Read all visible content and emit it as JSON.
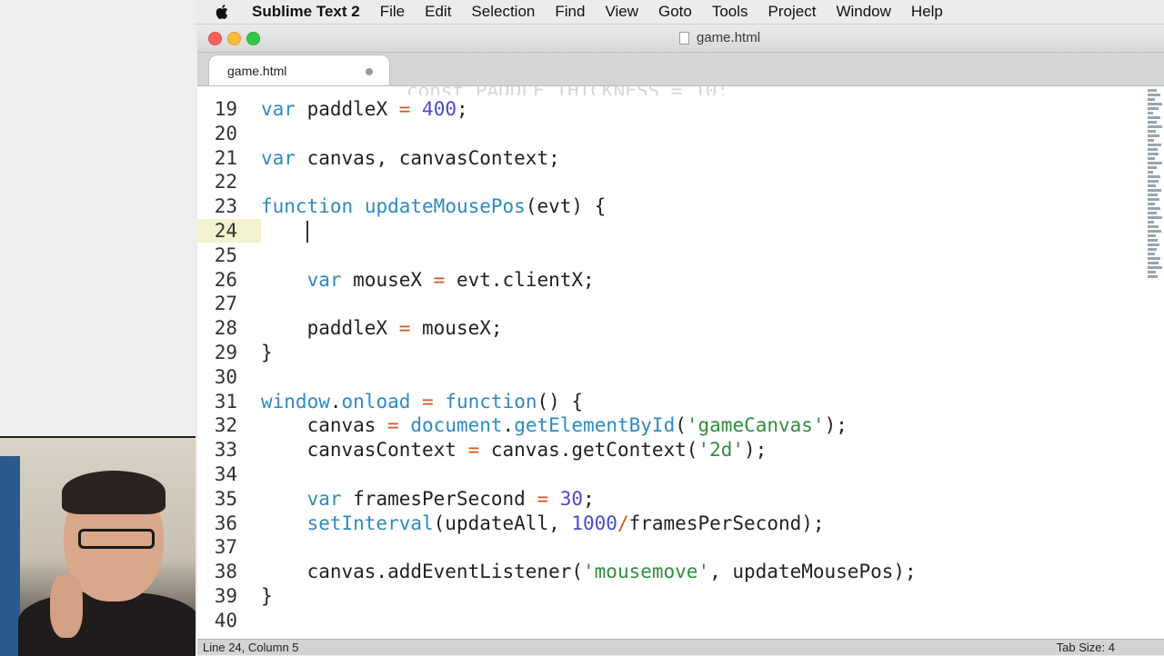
{
  "menubar": {
    "app_name": "Sublime Text 2",
    "items": [
      "File",
      "Edit",
      "Selection",
      "Find",
      "View",
      "Goto",
      "Tools",
      "Project",
      "Window",
      "Help"
    ]
  },
  "window": {
    "title": "game.html"
  },
  "tab": {
    "label": "game.html"
  },
  "editor": {
    "current_line": "24",
    "lines": [
      {
        "n": "19",
        "tokens": [
          [
            "kw",
            "var"
          ],
          [
            "pl",
            " paddleX "
          ],
          [
            "op",
            "="
          ],
          [
            "pl",
            " "
          ],
          [
            "num",
            "400"
          ],
          [
            "pl",
            ";"
          ]
        ]
      },
      {
        "n": "20",
        "tokens": []
      },
      {
        "n": "21",
        "tokens": [
          [
            "kw",
            "var"
          ],
          [
            "pl",
            " canvas, canvasContext;"
          ]
        ]
      },
      {
        "n": "22",
        "tokens": []
      },
      {
        "n": "23",
        "tokens": [
          [
            "kw",
            "function"
          ],
          [
            "pl",
            " "
          ],
          [
            "fn",
            "updateMousePos"
          ],
          [
            "pl",
            "(evt) {"
          ]
        ]
      },
      {
        "n": "24",
        "tokens": []
      },
      {
        "n": "25",
        "tokens": []
      },
      {
        "n": "26",
        "tokens": [
          [
            "pl",
            "    "
          ],
          [
            "kw",
            "var"
          ],
          [
            "pl",
            " mouseX "
          ],
          [
            "op",
            "="
          ],
          [
            "pl",
            " evt.clientX;"
          ]
        ]
      },
      {
        "n": "27",
        "tokens": []
      },
      {
        "n": "28",
        "tokens": [
          [
            "pl",
            "    paddleX "
          ],
          [
            "op",
            "="
          ],
          [
            "pl",
            " mouseX;"
          ]
        ]
      },
      {
        "n": "29",
        "tokens": [
          [
            "pl",
            "}"
          ]
        ]
      },
      {
        "n": "30",
        "tokens": []
      },
      {
        "n": "31",
        "tokens": [
          [
            "bi",
            "window"
          ],
          [
            "pl",
            "."
          ],
          [
            "bi",
            "onload"
          ],
          [
            "pl",
            " "
          ],
          [
            "op",
            "="
          ],
          [
            "pl",
            " "
          ],
          [
            "kw",
            "function"
          ],
          [
            "pl",
            "() {"
          ]
        ]
      },
      {
        "n": "32",
        "tokens": [
          [
            "pl",
            "    canvas "
          ],
          [
            "op",
            "="
          ],
          [
            "pl",
            " "
          ],
          [
            "bi",
            "document"
          ],
          [
            "pl",
            "."
          ],
          [
            "bi",
            "getElementById"
          ],
          [
            "pl",
            "("
          ],
          [
            "str",
            "'gameCanvas'"
          ],
          [
            "pl",
            ");"
          ]
        ]
      },
      {
        "n": "33",
        "tokens": [
          [
            "pl",
            "    canvasContext "
          ],
          [
            "op",
            "="
          ],
          [
            "pl",
            " canvas.getContext("
          ],
          [
            "str",
            "'2d'"
          ],
          [
            "pl",
            ");"
          ]
        ]
      },
      {
        "n": "34",
        "tokens": []
      },
      {
        "n": "35",
        "tokens": [
          [
            "pl",
            "    "
          ],
          [
            "kw",
            "var"
          ],
          [
            "pl",
            " framesPerSecond "
          ],
          [
            "op",
            "="
          ],
          [
            "pl",
            " "
          ],
          [
            "num",
            "30"
          ],
          [
            "pl",
            ";"
          ]
        ]
      },
      {
        "n": "36",
        "tokens": [
          [
            "pl",
            "    "
          ],
          [
            "bi",
            "setInterval"
          ],
          [
            "pl",
            "(updateAll, "
          ],
          [
            "num",
            "1000"
          ],
          [
            "op",
            "/"
          ],
          [
            "pl",
            "framesPerSecond);"
          ]
        ]
      },
      {
        "n": "37",
        "tokens": []
      },
      {
        "n": "38",
        "tokens": [
          [
            "pl",
            "    canvas.addEventListener("
          ],
          [
            "str",
            "'mousemove'"
          ],
          [
            "pl",
            ", updateMousePos);"
          ]
        ]
      },
      {
        "n": "39",
        "tokens": [
          [
            "pl",
            "}"
          ]
        ]
      },
      {
        "n": "40",
        "tokens": []
      }
    ]
  },
  "status": {
    "position": "Line 24, Column 5",
    "tab_size": "Tab Size: 4"
  }
}
